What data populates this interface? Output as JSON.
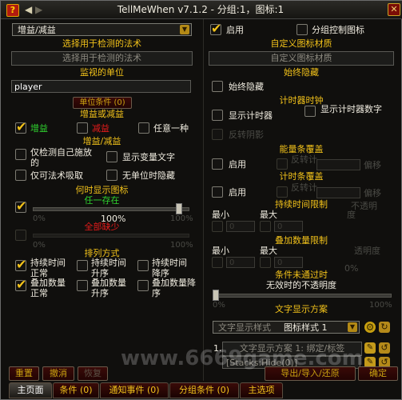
{
  "window": {
    "title": "TellMeWhen v7.1.2 - 分组:1，图标:1",
    "close_icon": "close-icon",
    "back_icon": "arrow-left-icon"
  },
  "left": {
    "type_dropdown": "增益/减益",
    "spell_header": "选择用于检测的法术",
    "spell_placeholder": "选择用于检测的法术",
    "unit_header": "监视的单位",
    "unit_value": "player",
    "unit_conditions_btn": "单位条件 (0)",
    "buff_debuff_header": "增益或减益",
    "buff_label": "增益",
    "debuff_label": "减益",
    "either_label": "任意一种",
    "buff_debuff_sub": "增益/减益",
    "only_mine_label": "仅检测自己施放的",
    "show_var_text_label": "显示变量文字",
    "only_stealable_label": "仅可法术吸取",
    "hide_no_unit_label": "无单位时隐藏",
    "when_show_header": "何时显示图标",
    "any_exists_label": "任一存在",
    "slider_min1": "0%",
    "slider_max1": "100%",
    "slider_value": "100%",
    "all_missing_label": "全部缺少",
    "slider_min2": "0%",
    "slider_max2": "100%",
    "sort_header": "排列方式",
    "sort_items": [
      "持续时间正常",
      "持续时间升序",
      "持续时间降序",
      "叠加数量正常",
      "叠加数量升序",
      "叠加数量降序"
    ],
    "reset_btn": "重置",
    "undo_btn": "撤消",
    "redo_btn": "恢复"
  },
  "right": {
    "enable_label": "启用",
    "group_control_label": "分组控制图标",
    "custom_texture_header": "自定义图标材质",
    "custom_texture_placeholder": "自定义图标材质",
    "always_hide_header": "始终隐藏",
    "always_hide_label": "始终隐藏",
    "timer_header": "计时器时钟",
    "show_timer_label": "显示计时器",
    "show_timer_text_label": "显示计时器数字",
    "reverse_shadow_label": "反转阴影",
    "energy_header": "能量条覆盖",
    "energy_enable_label": "启用",
    "reverse_label": "反转计",
    "offset_label": "偏移",
    "timer_bar_header": "计时条覆盖",
    "timer_bar_enable_label": "启用",
    "duration_limit_header": "持续时间限制",
    "min_label": "最小",
    "max_label": "最大",
    "duration_opacity_label": "度",
    "duration_opacity_prefix": "不透明",
    "stack_limit_header": "叠加数量限制",
    "stack_min_label": "最小",
    "stack_max_label": "最大",
    "stack_opacity_label": "0%",
    "stack_opacity_suffix": "透明度",
    "condition_fail_header": "条件未通过时",
    "invalid_opacity_label": "无效时的不透明度",
    "opacity_min": "0%",
    "opacity_max": "100%",
    "text_display_header": "文字显示方案",
    "text_layout_dropdown": "文字显示样式",
    "icon_style_label": "图标样式 1",
    "layout_row_num": "1.",
    "layout_row_text": "文字显示方案 1: 绑定/标签",
    "layout_row2_text": "[Stacks:Hide(0)]",
    "import_export_btn": "导出/导入/还原",
    "confirm_btn": "确定"
  },
  "tabs": [
    "主页面",
    "条件 (0)",
    "通知事件 (0)",
    "分组条件 (0)",
    "主选项"
  ],
  "watermark": "www.6669game.com"
}
